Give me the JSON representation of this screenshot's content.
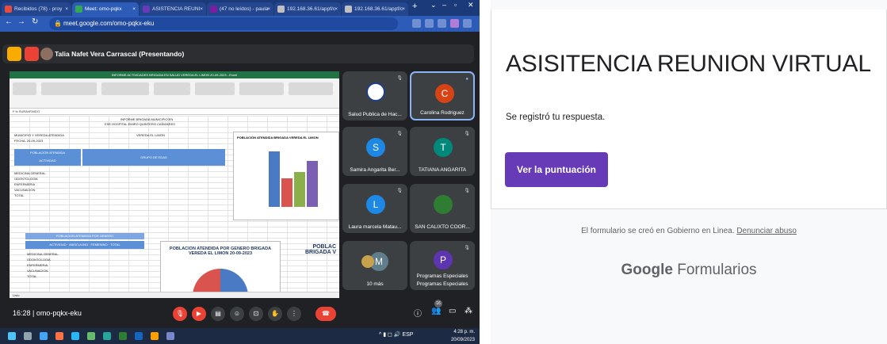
{
  "browser": {
    "tabs": [
      {
        "label": "Recibidos (78) - proy",
        "fav": "#e84c3d"
      },
      {
        "label": "Meet: omo-pqkx",
        "fav": "#34a853",
        "active": true
      },
      {
        "label": "ASISTENCIA REUNI",
        "fav": "#673ab7"
      },
      {
        "label": "(47 no leídos) - paula",
        "fav": "#7b1fa2"
      },
      {
        "label": "192.168.36.61/appf/c",
        "fav": "#c0c0c0"
      },
      {
        "label": "192.168.36.61/appf/c",
        "fav": "#c0c0c0"
      }
    ],
    "new_tab": "+",
    "url": "meet.google.com/omo-pqkx-eku"
  },
  "meet": {
    "presenter": "Talia Nafet Vera Carrascal (Presentando)",
    "meeting_code": "16:28  |  omo-pqkx-eku",
    "participants": [
      {
        "name": "Salud Publica de Hac...",
        "initial": "",
        "color": "#ffffff"
      },
      {
        "name": "Carolina Rodriguez",
        "initial": "C",
        "color": "#d84315"
      },
      {
        "name": "Samira Angarita Ber...",
        "initial": "S",
        "color": "#1e88e5"
      },
      {
        "name": "TATIANA ANGARITA",
        "initial": "T",
        "color": "#00897b"
      },
      {
        "name": "Laura marcela Matau...",
        "initial": "L",
        "color": "#1e88e5"
      },
      {
        "name": "SAN CALIXTO COOR...",
        "initial": "",
        "color": "#2e7d32"
      },
      {
        "name": "10 más",
        "initial": "M",
        "color": "#607d8b"
      },
      {
        "name": "Programas Especiales",
        "initial": "P",
        "color": "#5e35b1"
      }
    ],
    "participants_count": "16",
    "shared": {
      "title": "INFORME ACTIVIDADES BRIGADA EN SALUD VEREDA EL LIMON 20-09-2023 - Excel",
      "formula": "F  fx  SURAVENIDO",
      "heading1": "INFORME BRIGADA MUNICIPIO EN",
      "heading2": "ESE HOSPITAL EMIRO QUINTERO CAÑIZARES",
      "row1": "MUNICIPIO Y VEREDA ATENDIDA",
      "row1b": "VEREDA EL LIMON",
      "row2": "FECHA: 20-09-2023",
      "table1_title": "POBLACIÓN ATENDIDA",
      "table1_col": "ACTIVIDAD",
      "table1_group": "GRUPO DE EDAD",
      "activities": [
        "MEDICINA GENERAL",
        "ODONTOLOGIA",
        "ENFERMERIA",
        "VACUNACION",
        "TOTAL"
      ],
      "chart1_title": "POBLACIÓN ATENDIDA BRIGADA VEREDA EL LIMON",
      "chart1_labels": [
        "MEDICINA GENERAL",
        "ODONTOLOGIA",
        "ENFERMERIA",
        "VACUNACION"
      ],
      "table2_title": "POBLACION ATENDIDA POR GENERO",
      "table2_cols": [
        "ACTIVIDAD",
        "MASCULINO",
        "FEMENINO",
        "TOTAL"
      ],
      "chart2_title": "POBLACION ATENDIDA POR GENERO BRIGADA VEREDA EL LIMON 20-09-2023",
      "chart3_title": "POBLAC BRIGADA V",
      "status": "Listo"
    }
  },
  "form": {
    "title": "ASISITENCIA REUNION VIRTUAL",
    "confirmation": "Se registró tu respuesta.",
    "score_button": "Ver la puntuación",
    "footer_text": "El formulario se creó en Gobierno en Linea.",
    "footer_link": "Denunciar abuso",
    "logo_bold": "Google",
    "logo_rest": " Formularios"
  },
  "taskbar": {
    "time": "4:28 p. m.",
    "date": "20/09/2023",
    "lang": "ESP"
  },
  "colors": {
    "form_accent": "#673ab7",
    "meet_dark": "#202124",
    "browser_blue": "#2c5bb8"
  }
}
